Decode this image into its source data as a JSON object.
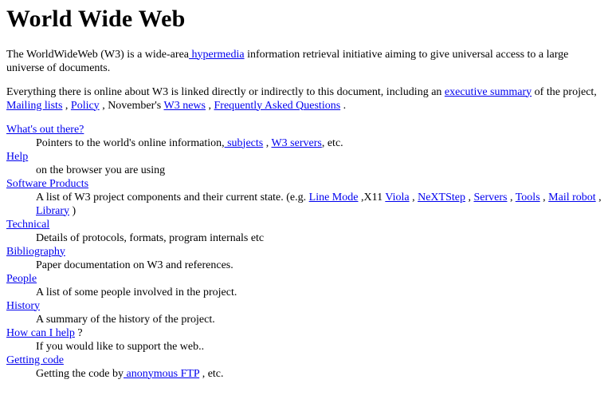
{
  "title": "World Wide Web",
  "intro": {
    "before": "The WorldWideWeb (W3) is a wide-area",
    "link": " hypermedia",
    "after": " information retrieval initiative aiming to give universal access to a large universe of documents."
  },
  "overview": {
    "text1": "Everything there is online about W3 is linked directly or indirectly to this document, including an ",
    "link_exec": "executive summary",
    "text2": " of the project, ",
    "link_mailing": "Mailing lists",
    "text3": " , ",
    "link_policy": "Policy",
    "text4": " , November's ",
    "link_news": "W3 news",
    "text5": " , ",
    "link_faq": "Frequently Asked Questions",
    "text6": " ."
  },
  "items": {
    "whats_out": {
      "term": "What's out there?",
      "desc1": "Pointers to the world's online information,",
      "link1": " subjects",
      "desc2": " , ",
      "link2": "W3 servers",
      "desc3": ", etc."
    },
    "help": {
      "term": "Help",
      "desc": "on the browser you are using"
    },
    "software": {
      "term": "Software Products",
      "desc1": "A list of W3 project components and their current state. (e.g. ",
      "link_linemode": "Line Mode",
      "desc2": " ,X11 ",
      "link_viola": "Viola",
      "desc3": " , ",
      "link_nextstep": "NeXTStep",
      "desc4": " , ",
      "link_servers": "Servers",
      "desc5": " , ",
      "link_tools": "Tools",
      "desc6": " , ",
      "link_mailrobot": "Mail robot",
      "desc7": " , ",
      "link_library": "Library",
      "desc8": " )"
    },
    "technical": {
      "term": "Technical",
      "desc": "Details of protocols, formats, program internals etc"
    },
    "bibliography": {
      "term": "Bibliography",
      "desc": "Paper documentation on W3 and references."
    },
    "people": {
      "term": "People",
      "desc": "A list of some people involved in the project."
    },
    "history": {
      "term": "History",
      "desc": "A summary of the history of the project."
    },
    "how_help": {
      "term": "How can I help",
      "term_suffix": " ?",
      "desc": "If you would like to support the web.."
    },
    "getting_code": {
      "term": "Getting code",
      "desc1": "Getting the code by",
      "link": " anonymous FTP",
      "desc2": " , etc."
    }
  },
  "colors": {
    "link": "#0000ee",
    "text": "#000000",
    "background": "#ffffff"
  }
}
